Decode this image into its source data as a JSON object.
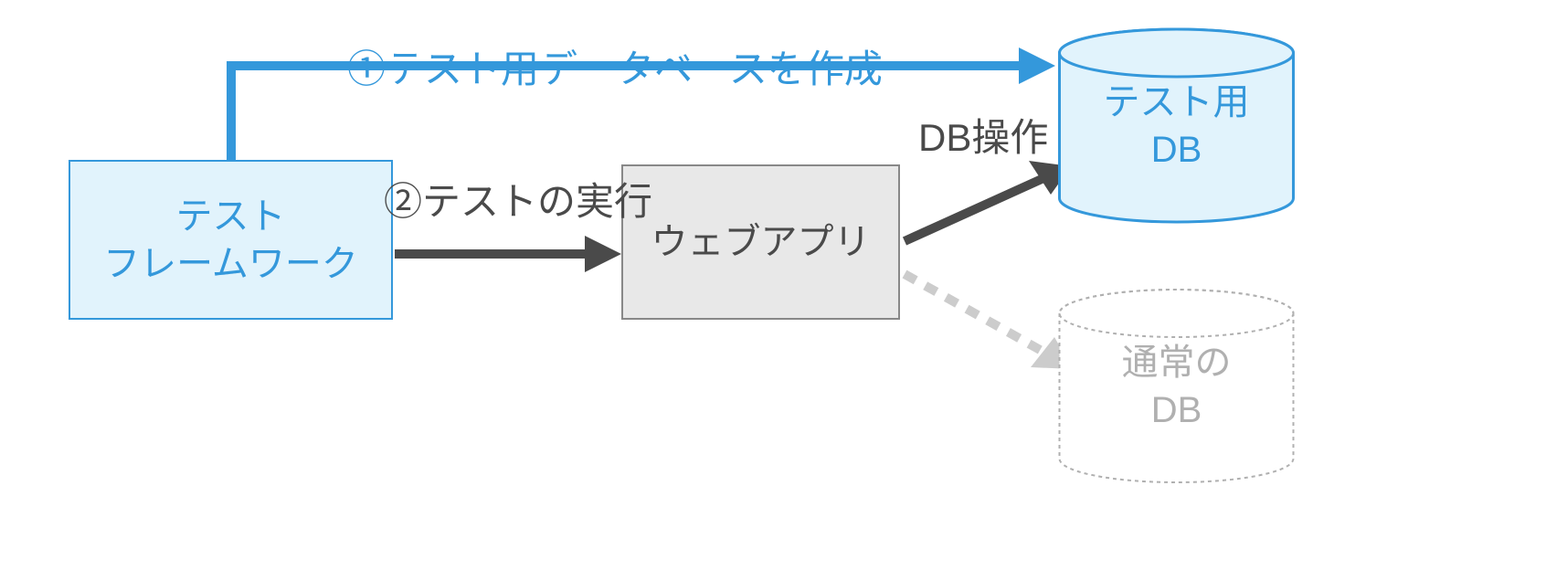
{
  "nodes": {
    "framework": {
      "line1": "テスト",
      "line2": "フレームワーク"
    },
    "webapp": {
      "label": "ウェブアプリ"
    },
    "test_db": {
      "line1": "テスト用",
      "line2": "DB"
    },
    "normal_db": {
      "line1": "通常の",
      "line2": "DB"
    }
  },
  "labels": {
    "step1": "①テスト用データベースを作成",
    "step2": "②テストの実行",
    "db_operation": "DB操作"
  },
  "colors": {
    "blue": "#3498DB",
    "light_blue_fill": "#E1F3FC",
    "grey_fill": "#E8E8E8",
    "dark": "#4A4A4A",
    "light_grey": "#CCCCCC"
  }
}
